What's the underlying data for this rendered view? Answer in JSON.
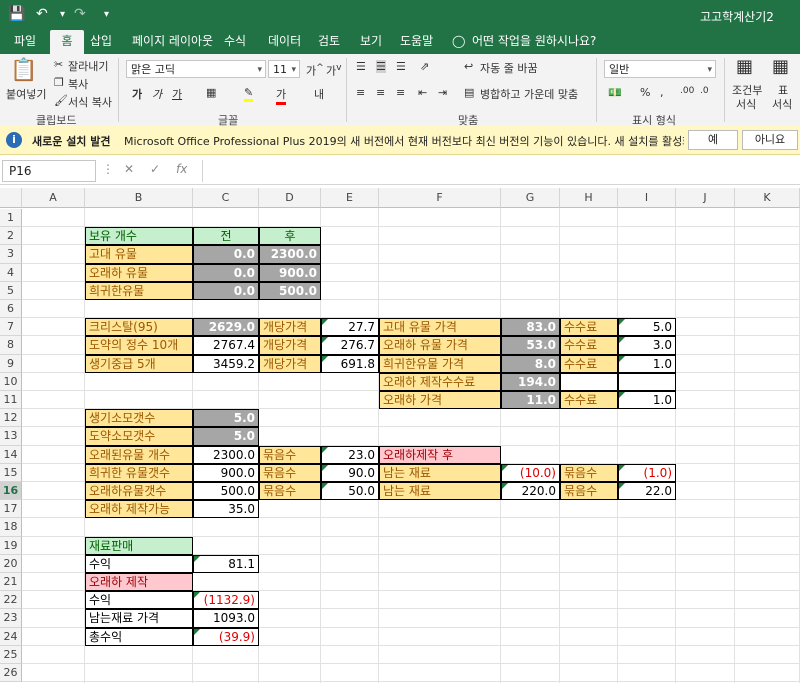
{
  "window": {
    "title": "고고학계산기2"
  },
  "ribbon_tabs": [
    "파일",
    "홈",
    "삽입",
    "페이지 레이아웃",
    "수식",
    "데이터",
    "검토",
    "보기",
    "도움말"
  ],
  "tell_me": "어떤 작업을 원하시나요?",
  "clipboard": {
    "paste": "붙여넣기",
    "cut": "잘라내기",
    "copy": "복사",
    "format_painter": "서식 복사",
    "group": "클립보드"
  },
  "font": {
    "name": "맑은 고딕",
    "size": "11",
    "group": "글꼴"
  },
  "alignment": {
    "wrap": "자동 줄 바꿈",
    "merge": "병합하고 가운데 맞춤",
    "group": "맞춤"
  },
  "number": {
    "format": "일반",
    "group": "표시 형식"
  },
  "styles": {
    "cond": "조건부",
    "cond2": "서식",
    "table": "표",
    "table2": "서식"
  },
  "message": {
    "title": "새로운 설치 발견",
    "text": "Microsoft Office Professional Plus 2019의 새 버전에서 현재 버전보다 최신 버전의 기능이 있습니다. 새 설치를 활성화하시겠습니까?",
    "yes": "예",
    "no": "아니요"
  },
  "formula_bar": {
    "name_box": "P16",
    "fx": "fx",
    "value": ""
  },
  "columns": [
    "A",
    "B",
    "C",
    "D",
    "E",
    "F",
    "G",
    "H",
    "I",
    "J",
    "K"
  ],
  "rows": [
    "1",
    "2",
    "3",
    "4",
    "5",
    "6",
    "7",
    "8",
    "9",
    "10",
    "11",
    "12",
    "13",
    "14",
    "15",
    "16",
    "17",
    "18",
    "19",
    "20",
    "21",
    "22",
    "23",
    "24",
    "25",
    "26"
  ],
  "cells": {
    "B2": "보유 개수",
    "C2": "전",
    "D2": "후",
    "B3": "고대 유물",
    "C3": "0.0",
    "D3": "2300.0",
    "B4": "오래하 유물",
    "C4": "0.0",
    "D4": "900.0",
    "B5": "희귀한유물",
    "C5": "0.0",
    "D5": "500.0",
    "B7": "크리스탈(95)",
    "C7": "2629.0",
    "D7": "개당가격",
    "E7": "27.7",
    "F7": "고대 유물 가격",
    "G7": "83.0",
    "H7": "수수료",
    "I7": "5.0",
    "B8": "도약의 정수 10개",
    "C8": "2767.4",
    "D8": "개당가격",
    "E8": "276.7",
    "F8": "오래하 유물 가격",
    "G8": "53.0",
    "H8": "수수료",
    "I8": "3.0",
    "B9": "생기중급 5개",
    "C9": "3459.2",
    "D9": "개당가격",
    "E9": "691.8",
    "F9": "희귀한유물 가격",
    "G9": "8.0",
    "H9": "수수료",
    "I9": "1.0",
    "F10": "오래하 제작수수료",
    "G10": "194.0",
    "F11": "오래하 가격",
    "G11": "11.0",
    "H11": "수수료",
    "I11": "1.0",
    "B12": "생기소모갯수",
    "C12": "5.0",
    "B13": "도약소모갯수",
    "C13": "5.0",
    "B14": "오래된유물 개수",
    "C14": "2300.0",
    "D14": "묶음수",
    "E14": "23.0",
    "F14": "오래하제작 후",
    "B15": "희귀한 유물갯수",
    "C15": "900.0",
    "D15": "묶음수",
    "E15": "90.0",
    "F15": "남는 재료",
    "G15": "(10.0)",
    "H15": "묶음수",
    "I15": "(1.0)",
    "B16": "오래하유물갯수",
    "C16": "500.0",
    "D16": "묶음수",
    "E16": "50.0",
    "F16": "남는 재료",
    "G16": "220.0",
    "H16": "묶음수",
    "I16": "22.0",
    "B17": "오래하 제작가능",
    "C17": "35.0",
    "B19": "재료판매",
    "B20": "수익",
    "C20": "81.1",
    "B21": "오래하 제작",
    "B22": "수익",
    "C22": "(1132.9)",
    "B23": "남는재료 가격",
    "C23": "1093.0",
    "B24": "총수익",
    "C24": "(39.9)"
  }
}
